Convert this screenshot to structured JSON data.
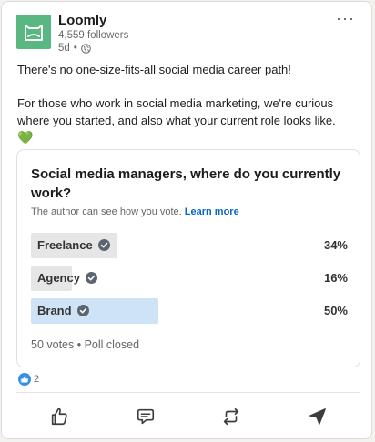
{
  "author": {
    "name": "Loomly",
    "followers": "4,559 followers",
    "time": "5d",
    "separator": "•"
  },
  "menu_label": "···",
  "post": {
    "line1": "There's no one-size-fits-all social media career path!",
    "line2": "For those who work in social media marketing, we're curious where you started, and also what your current role looks like.",
    "emoji": "💚"
  },
  "poll": {
    "question": "Social media managers, where do you currently work?",
    "note": "The author can see how you vote.",
    "learn_more": "Learn more",
    "options": [
      {
        "label": "Freelance",
        "percent": "34%",
        "fraction": 0.34,
        "selected": false
      },
      {
        "label": "Agency",
        "percent": "16%",
        "fraction": 0.16,
        "selected": false
      },
      {
        "label": "Brand",
        "percent": "50%",
        "fraction": 0.5,
        "selected": true
      }
    ],
    "footer": "50 votes • Poll closed"
  },
  "reactions": {
    "count": "2"
  },
  "actions": [
    {
      "icon": "like-icon"
    },
    {
      "icon": "comment-icon"
    },
    {
      "icon": "repost-icon"
    },
    {
      "icon": "send-icon"
    }
  ],
  "colors": {
    "logo": "#59b882",
    "link": "#0a66c2",
    "selected_bar": "#cfe3f7",
    "bar": "#e6e6e6",
    "like": "#378fe9"
  }
}
